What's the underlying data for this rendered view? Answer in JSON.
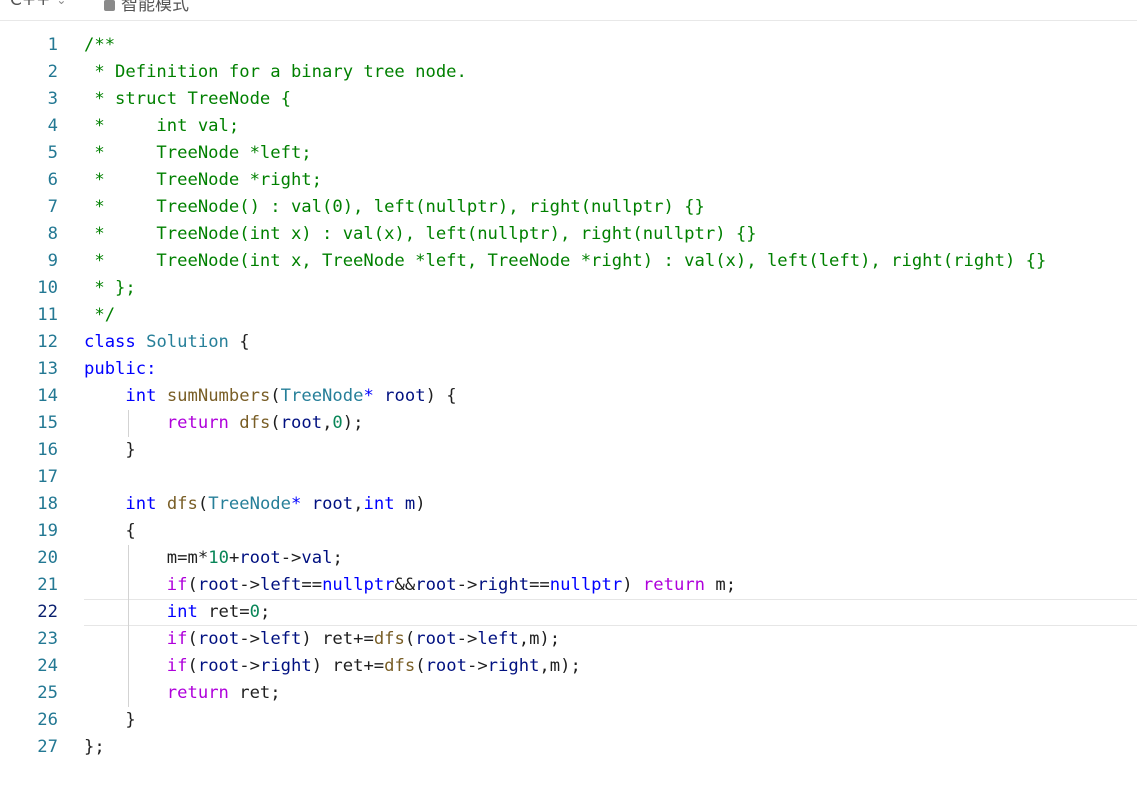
{
  "toolbar": {
    "language": "C++",
    "mode_label": "智能模式"
  },
  "colors": {
    "comment": "#008000",
    "keyword": "#0000ff",
    "control": "#af00db",
    "type": "#267f99",
    "function": "#795e26",
    "variable": "#001080",
    "number": "#098658",
    "line_number": "#237893"
  },
  "editor": {
    "current_line": 22,
    "lines": [
      {
        "n": "1",
        "guides": [],
        "tokens": [
          {
            "t": "/**",
            "c": "comment"
          }
        ]
      },
      {
        "n": "2",
        "guides": [],
        "tokens": [
          {
            "t": " * Definition for a binary tree node.",
            "c": "comment"
          }
        ]
      },
      {
        "n": "3",
        "guides": [],
        "tokens": [
          {
            "t": " * struct TreeNode {",
            "c": "comment"
          }
        ]
      },
      {
        "n": "4",
        "guides": [],
        "tokens": [
          {
            "t": " *     int val;",
            "c": "comment"
          }
        ]
      },
      {
        "n": "5",
        "guides": [],
        "tokens": [
          {
            "t": " *     TreeNode *left;",
            "c": "comment"
          }
        ]
      },
      {
        "n": "6",
        "guides": [],
        "tokens": [
          {
            "t": " *     TreeNode *right;",
            "c": "comment"
          }
        ]
      },
      {
        "n": "7",
        "guides": [],
        "tokens": [
          {
            "t": " *     TreeNode() : val(0), left(nullptr), right(nullptr) {}",
            "c": "comment"
          }
        ]
      },
      {
        "n": "8",
        "guides": [],
        "tokens": [
          {
            "t": " *     TreeNode(int x) : val(x), left(nullptr), right(nullptr) {}",
            "c": "comment"
          }
        ]
      },
      {
        "n": "9",
        "guides": [],
        "tokens": [
          {
            "t": " *     TreeNode(int x, TreeNode *left, TreeNode *right) : val(x), left(left), right(right) {}",
            "c": "comment"
          }
        ]
      },
      {
        "n": "10",
        "guides": [],
        "tokens": [
          {
            "t": " * };",
            "c": "comment"
          }
        ]
      },
      {
        "n": "11",
        "guides": [],
        "tokens": [
          {
            "t": " */",
            "c": "comment"
          }
        ]
      },
      {
        "n": "12",
        "guides": [],
        "tokens": [
          {
            "t": "class",
            "c": "kw"
          },
          {
            "t": " ",
            "c": "plain"
          },
          {
            "t": "Solution",
            "c": "type"
          },
          {
            "t": " {",
            "c": "plain"
          }
        ]
      },
      {
        "n": "13",
        "guides": [],
        "tokens": [
          {
            "t": "public:",
            "c": "kw"
          }
        ]
      },
      {
        "n": "14",
        "guides": [],
        "tokens": [
          {
            "t": "    ",
            "c": "plain"
          },
          {
            "t": "int",
            "c": "kw"
          },
          {
            "t": " ",
            "c": "plain"
          },
          {
            "t": "sumNumbers",
            "c": "fn"
          },
          {
            "t": "(",
            "c": "plain"
          },
          {
            "t": "TreeNode",
            "c": "type"
          },
          {
            "t": "*",
            "c": "kw"
          },
          {
            "t": " ",
            "c": "plain"
          },
          {
            "t": "root",
            "c": "var"
          },
          {
            "t": ") {",
            "c": "plain"
          }
        ]
      },
      {
        "n": "15",
        "guides": [
          1
        ],
        "tokens": [
          {
            "t": "        ",
            "c": "plain"
          },
          {
            "t": "return",
            "c": "ctrl"
          },
          {
            "t": " ",
            "c": "plain"
          },
          {
            "t": "dfs",
            "c": "fn"
          },
          {
            "t": "(",
            "c": "plain"
          },
          {
            "t": "root",
            "c": "var"
          },
          {
            "t": ",",
            "c": "plain"
          },
          {
            "t": "0",
            "c": "num"
          },
          {
            "t": ");",
            "c": "plain"
          }
        ]
      },
      {
        "n": "16",
        "guides": [],
        "tokens": [
          {
            "t": "    }",
            "c": "plain"
          }
        ]
      },
      {
        "n": "17",
        "guides": [],
        "tokens": []
      },
      {
        "n": "18",
        "guides": [],
        "tokens": [
          {
            "t": "    ",
            "c": "plain"
          },
          {
            "t": "int",
            "c": "kw"
          },
          {
            "t": " ",
            "c": "plain"
          },
          {
            "t": "dfs",
            "c": "fn"
          },
          {
            "t": "(",
            "c": "plain"
          },
          {
            "t": "TreeNode",
            "c": "type"
          },
          {
            "t": "*",
            "c": "kw"
          },
          {
            "t": " ",
            "c": "plain"
          },
          {
            "t": "root",
            "c": "var"
          },
          {
            "t": ",",
            "c": "plain"
          },
          {
            "t": "int",
            "c": "kw"
          },
          {
            "t": " ",
            "c": "plain"
          },
          {
            "t": "m",
            "c": "var"
          },
          {
            "t": ")",
            "c": "plain"
          }
        ]
      },
      {
        "n": "19",
        "guides": [],
        "tokens": [
          {
            "t": "    {",
            "c": "plain"
          }
        ]
      },
      {
        "n": "20",
        "guides": [
          1
        ],
        "tokens": [
          {
            "t": "        ",
            "c": "plain"
          },
          {
            "t": "m",
            "c": "plain"
          },
          {
            "t": "=",
            "c": "plain"
          },
          {
            "t": "m",
            "c": "plain"
          },
          {
            "t": "*",
            "c": "plain"
          },
          {
            "t": "10",
            "c": "num"
          },
          {
            "t": "+",
            "c": "plain"
          },
          {
            "t": "root",
            "c": "var"
          },
          {
            "t": "->",
            "c": "plain"
          },
          {
            "t": "val",
            "c": "var"
          },
          {
            "t": ";",
            "c": "plain"
          }
        ]
      },
      {
        "n": "21",
        "guides": [
          1
        ],
        "tokens": [
          {
            "t": "        ",
            "c": "plain"
          },
          {
            "t": "if",
            "c": "ctrl"
          },
          {
            "t": "(",
            "c": "plain"
          },
          {
            "t": "root",
            "c": "var"
          },
          {
            "t": "->",
            "c": "plain"
          },
          {
            "t": "left",
            "c": "var"
          },
          {
            "t": "==",
            "c": "plain"
          },
          {
            "t": "nullptr",
            "c": "kw"
          },
          {
            "t": "&&",
            "c": "plain"
          },
          {
            "t": "root",
            "c": "var"
          },
          {
            "t": "->",
            "c": "plain"
          },
          {
            "t": "right",
            "c": "var"
          },
          {
            "t": "==",
            "c": "plain"
          },
          {
            "t": "nullptr",
            "c": "kw"
          },
          {
            "t": ") ",
            "c": "plain"
          },
          {
            "t": "return",
            "c": "ctrl"
          },
          {
            "t": " m;",
            "c": "plain"
          }
        ]
      },
      {
        "n": "22",
        "guides": [
          1
        ],
        "tokens": [
          {
            "t": "        ",
            "c": "plain"
          },
          {
            "t": "int",
            "c": "kw"
          },
          {
            "t": " ret=",
            "c": "plain"
          },
          {
            "t": "0",
            "c": "num"
          },
          {
            "t": ";",
            "c": "plain"
          }
        ]
      },
      {
        "n": "23",
        "guides": [
          1
        ],
        "tokens": [
          {
            "t": "        ",
            "c": "plain"
          },
          {
            "t": "if",
            "c": "ctrl"
          },
          {
            "t": "(",
            "c": "plain"
          },
          {
            "t": "root",
            "c": "var"
          },
          {
            "t": "->",
            "c": "plain"
          },
          {
            "t": "left",
            "c": "var"
          },
          {
            "t": ") ret+=",
            "c": "plain"
          },
          {
            "t": "dfs",
            "c": "fn"
          },
          {
            "t": "(",
            "c": "plain"
          },
          {
            "t": "root",
            "c": "var"
          },
          {
            "t": "->",
            "c": "plain"
          },
          {
            "t": "left",
            "c": "var"
          },
          {
            "t": ",m);",
            "c": "plain"
          }
        ]
      },
      {
        "n": "24",
        "guides": [
          1
        ],
        "tokens": [
          {
            "t": "        ",
            "c": "plain"
          },
          {
            "t": "if",
            "c": "ctrl"
          },
          {
            "t": "(",
            "c": "plain"
          },
          {
            "t": "root",
            "c": "var"
          },
          {
            "t": "->",
            "c": "plain"
          },
          {
            "t": "right",
            "c": "var"
          },
          {
            "t": ") ret+=",
            "c": "plain"
          },
          {
            "t": "dfs",
            "c": "fn"
          },
          {
            "t": "(",
            "c": "plain"
          },
          {
            "t": "root",
            "c": "var"
          },
          {
            "t": "->",
            "c": "plain"
          },
          {
            "t": "right",
            "c": "var"
          },
          {
            "t": ",m);",
            "c": "plain"
          }
        ]
      },
      {
        "n": "25",
        "guides": [
          1
        ],
        "tokens": [
          {
            "t": "        ",
            "c": "plain"
          },
          {
            "t": "return",
            "c": "ctrl"
          },
          {
            "t": " ret;",
            "c": "plain"
          }
        ]
      },
      {
        "n": "26",
        "guides": [],
        "tokens": [
          {
            "t": "    }",
            "c": "plain"
          }
        ]
      },
      {
        "n": "27",
        "guides": [],
        "tokens": [
          {
            "t": "};",
            "c": "plain"
          }
        ]
      }
    ]
  }
}
